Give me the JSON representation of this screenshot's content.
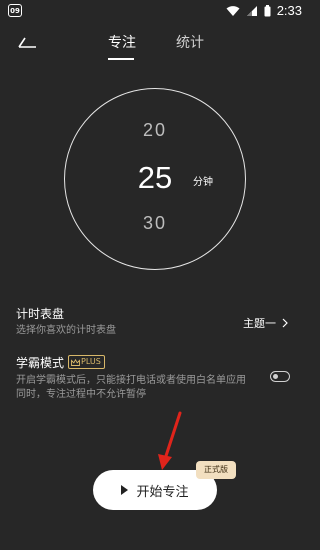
{
  "status_bar": {
    "app_icon_label": "09",
    "time": "2:33",
    "icons": [
      "wifi-icon",
      "signal-icon",
      "battery-icon"
    ]
  },
  "header": {
    "tabs": [
      {
        "label": "专注",
        "active": true
      },
      {
        "label": "统计",
        "active": false
      }
    ]
  },
  "dial": {
    "prev_value": "20",
    "current_value": "25",
    "next_value": "30",
    "unit": "分钟"
  },
  "settings": {
    "timer_face": {
      "title": "计时表盘",
      "subtitle": "选择你喜欢的计时表盘",
      "value": "主题一"
    },
    "study_mode": {
      "title": "学霸模式",
      "badge": "PLUS",
      "description_line1": "开启学霸模式后，只能接打电话或者使用白名单应用",
      "description_line2": "同时，专注过程中不允许暂停",
      "enabled": false
    }
  },
  "start_button": {
    "label": "开始专注",
    "badge": "正式版"
  },
  "colors": {
    "background": "#272727",
    "accent_gold": "#d8b86a",
    "badge_bg": "#f2dfc0",
    "annotation_arrow": "#e0241b"
  }
}
